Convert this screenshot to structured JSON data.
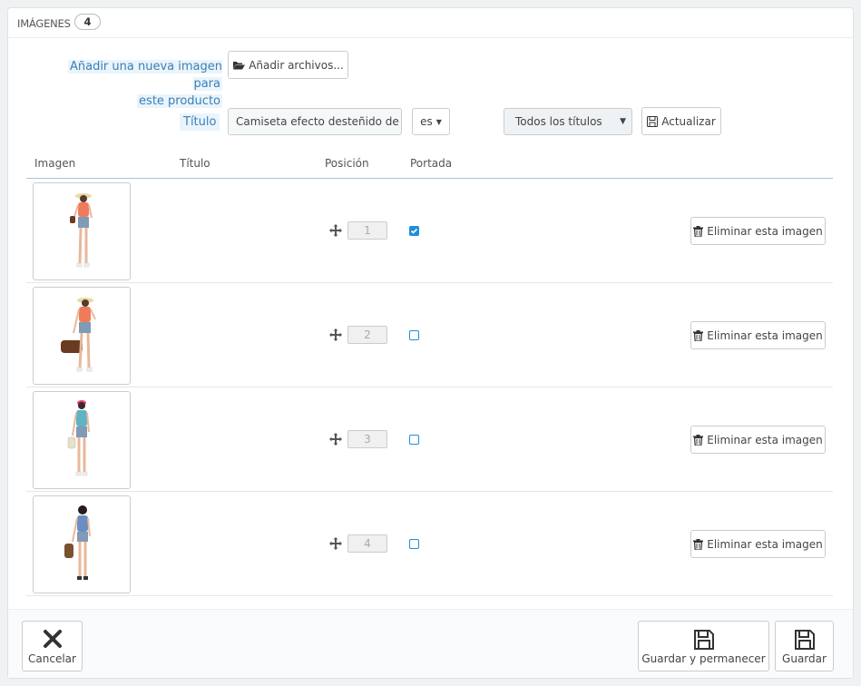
{
  "header": {
    "title": "IMÁGENES",
    "count": "4"
  },
  "add": {
    "label_line1": "Añadir una nueva imagen para",
    "label_line2": "este producto",
    "button": "Añadir archivos..."
  },
  "filters": {
    "title_label": "Título",
    "title_value": "Camiseta efecto desteñido de r",
    "lang": "es",
    "titles_select": "Todos los títulos",
    "update_button": "Actualizar"
  },
  "table": {
    "headers": [
      "Imagen",
      "Título",
      "Posición",
      "Portada"
    ],
    "rows": [
      {
        "title": "",
        "position": "1",
        "cover": true,
        "delete_label": "Eliminar esta imagen"
      },
      {
        "title": "",
        "position": "2",
        "cover": false,
        "delete_label": "Eliminar esta imagen"
      },
      {
        "title": "",
        "position": "3",
        "cover": false,
        "delete_label": "Eliminar esta imagen"
      },
      {
        "title": "",
        "position": "4",
        "cover": false,
        "delete_label": "Eliminar esta imagen"
      }
    ]
  },
  "footer": {
    "cancel": "Cancelar",
    "save_stay": "Guardar y permanecer",
    "save": "Guardar"
  },
  "colors": {
    "accent": "#1d8fd9",
    "label_bg": "#eaf4fb",
    "label_text": "#3b7fb6"
  }
}
